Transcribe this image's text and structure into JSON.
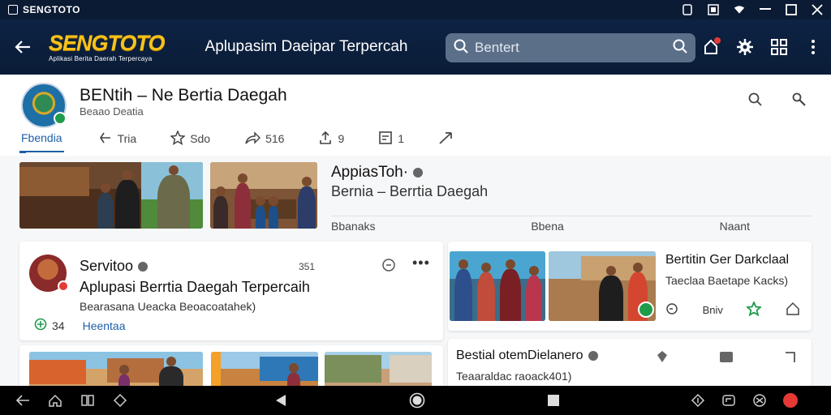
{
  "statusbar": {
    "app_name": "SENGTOTO"
  },
  "appbar": {
    "logo_main": "SENGTOTO",
    "logo_tag": "Aplikasi Berita Daerah Terpercaya",
    "title": "Aplupasim Daeipar Terpercah",
    "search_placeholder": "Bentert"
  },
  "channel": {
    "name": "BENtih – Ne Bertia Daegah",
    "subtitle": "Beaao Deatia",
    "tabs": [
      {
        "label": "Fbendia",
        "icon": "",
        "active": true
      },
      {
        "label": "Tria",
        "icon": "share-icon"
      },
      {
        "label": "Sdo",
        "icon": "star-icon"
      },
      {
        "label": "516",
        "icon": "forward-icon"
      },
      {
        "label": "9",
        "icon": "upload-icon"
      },
      {
        "label": "1",
        "icon": "comment-icon"
      },
      {
        "label": "",
        "icon": "send-icon"
      }
    ]
  },
  "feature": {
    "title": "AppiasToh·",
    "subtitle": "Bernia – Berrtia Daegah",
    "foot": [
      "Bbanaks",
      "Bbena",
      "Naant"
    ]
  },
  "card1": {
    "name": "Servitoo",
    "meta": "351",
    "title": "Aplupasi Berrtia Daegah Terpercaih",
    "desc": "Bearasana Ueacka Beoacoatahek)",
    "count": "34",
    "link": "Heentaa"
  },
  "card2": {
    "title": "Bertitin Ger Darkclaal",
    "subtitle": "Taeclaa Baetape Kacks)",
    "action_label": "Bniv"
  },
  "card4": {
    "title": "Bestial otemDielanero",
    "subtitle": "Teaaraldac raoack401)"
  },
  "colors": {
    "appbar": "#0d2344",
    "accent": "#1d5fa8",
    "logo": "#f6c21a",
    "verified": "#1f9b4c"
  }
}
